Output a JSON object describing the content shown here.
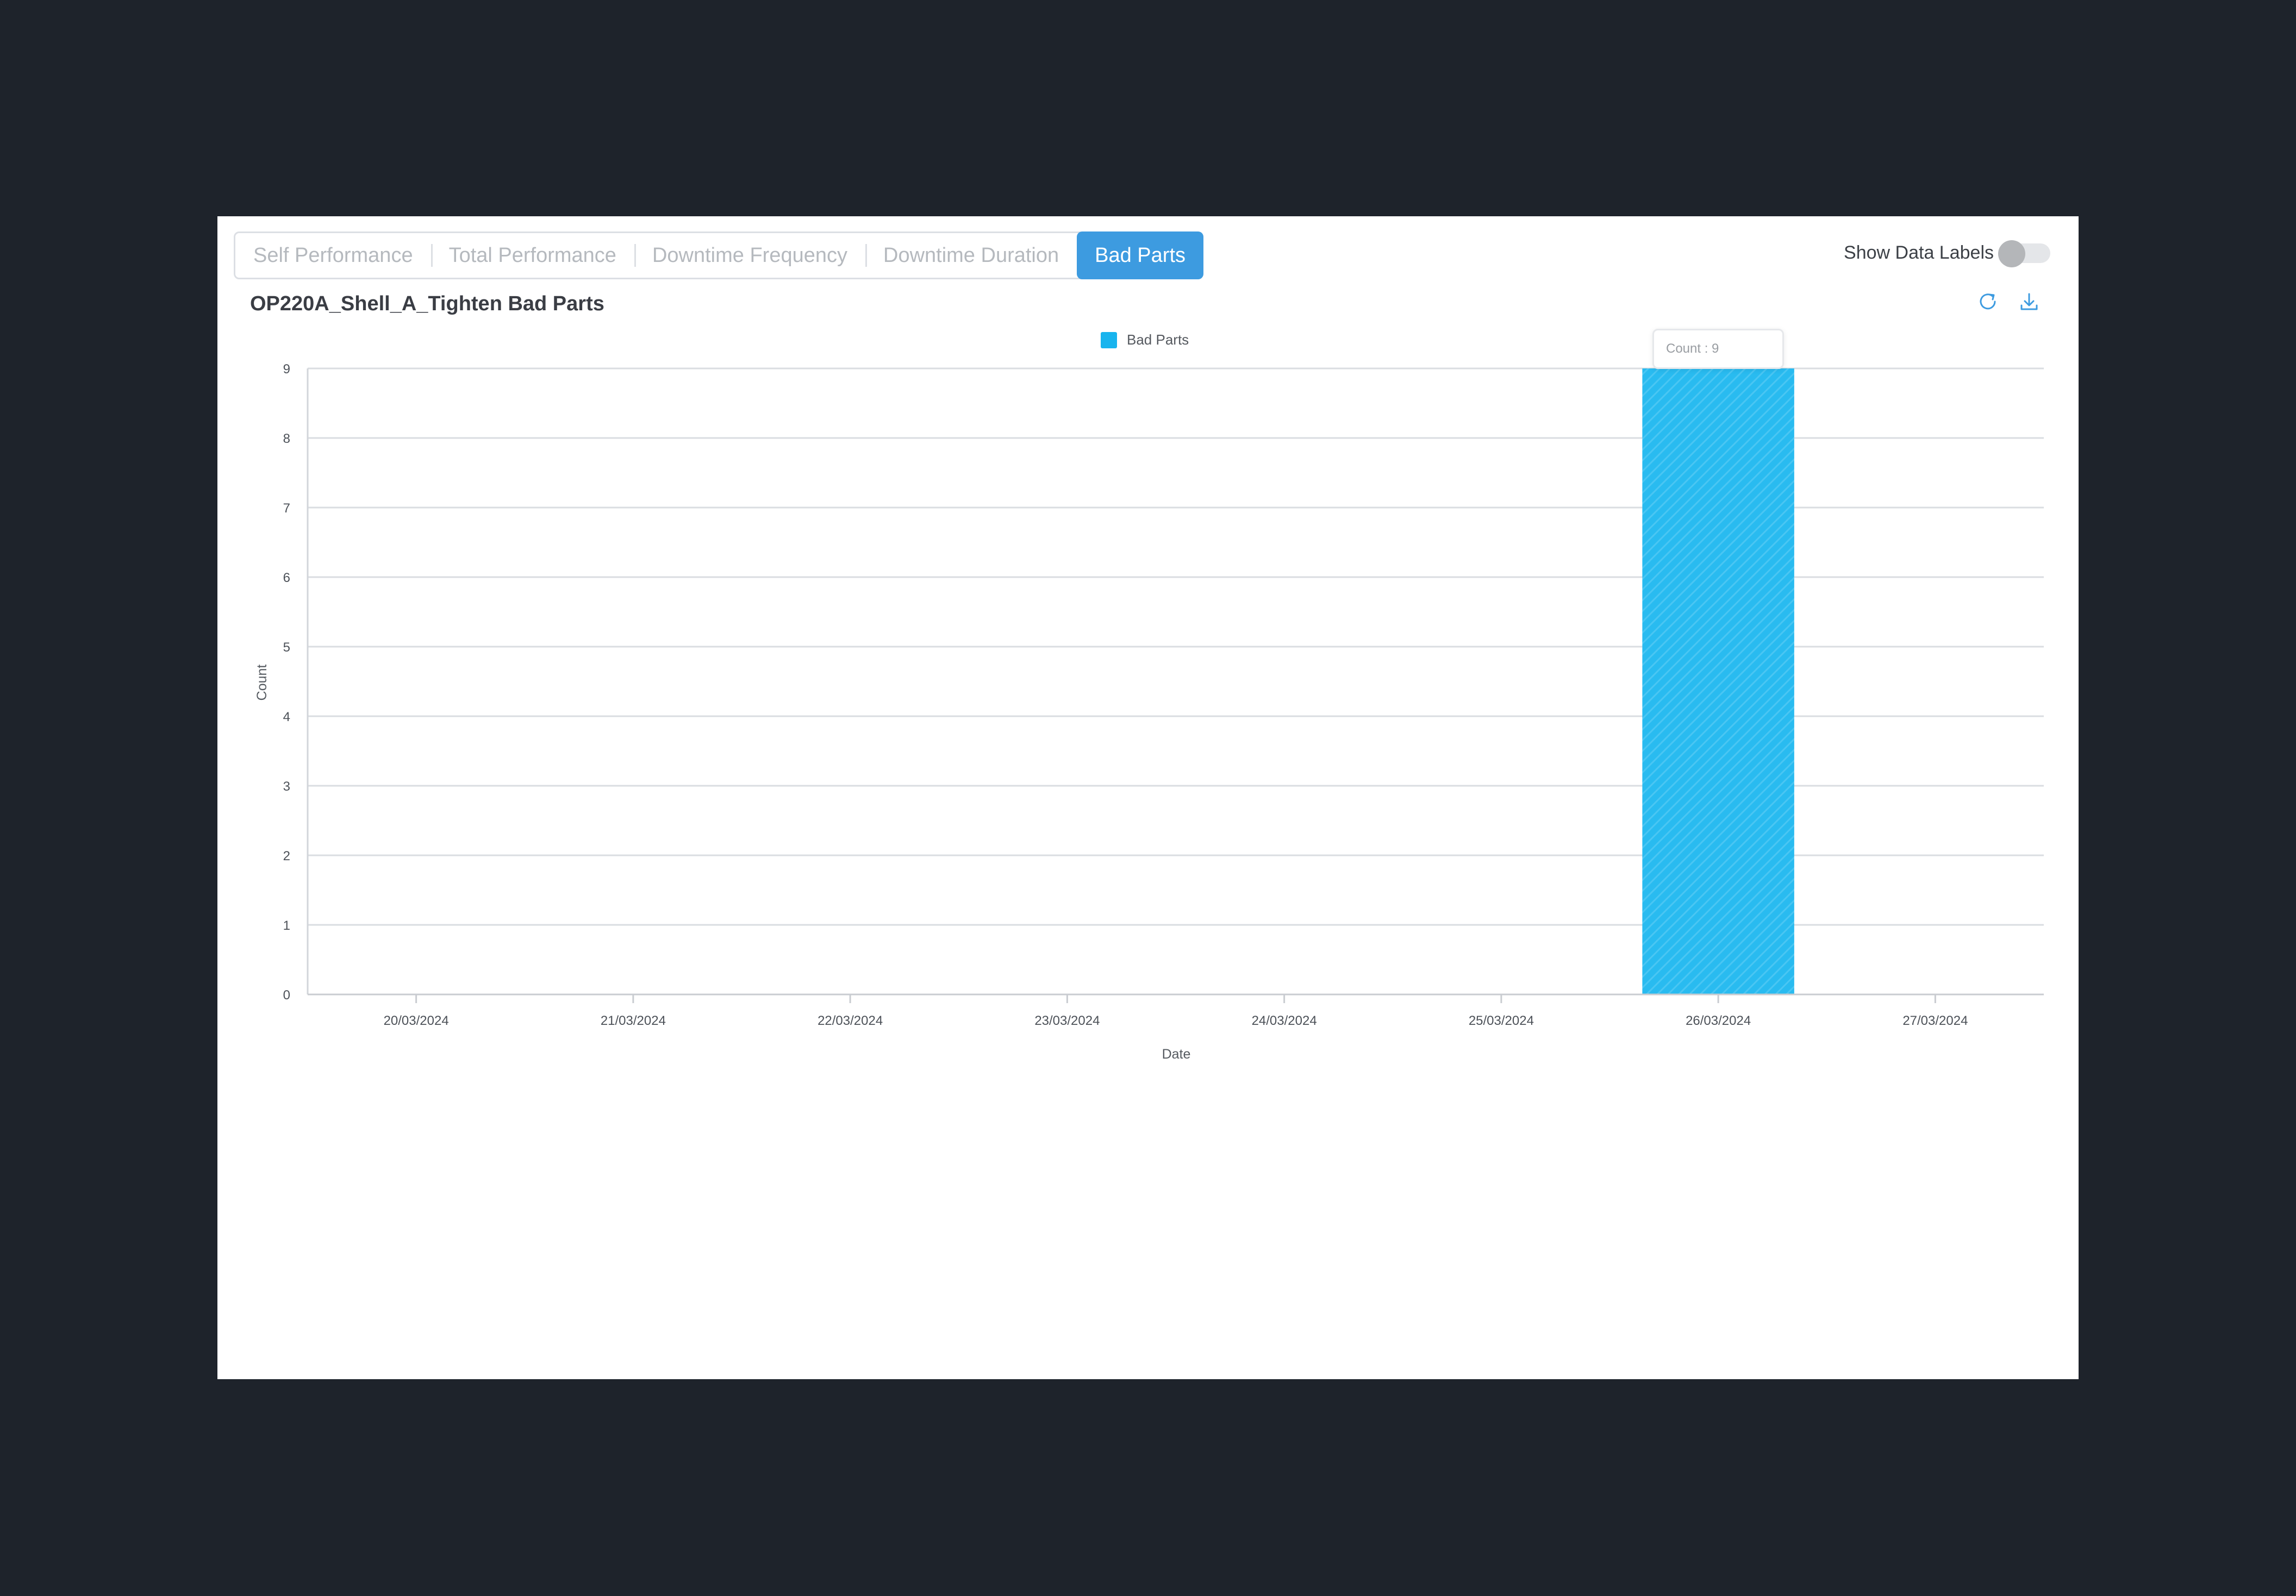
{
  "tabs": [
    {
      "label": "Self Performance",
      "active": false
    },
    {
      "label": "Total Performance",
      "active": false
    },
    {
      "label": "Downtime Frequency",
      "active": false
    },
    {
      "label": "Downtime Duration",
      "active": false
    },
    {
      "label": "Bad Parts",
      "active": true
    }
  ],
  "toggle": {
    "label": "Show Data Labels",
    "on": false
  },
  "toolbar": {
    "refresh_icon": "refresh-icon",
    "download_icon": "download-icon"
  },
  "tooltip": {
    "text": "Count : 9"
  },
  "colors": {
    "accent": "#3d9be0",
    "bar": "#18b4ee"
  },
  "chart_data": {
    "type": "bar",
    "title": "OP220A_Shell_A_Tighten Bad Parts",
    "xlabel": "Date",
    "ylabel": "Count",
    "categories": [
      "20/03/2024",
      "21/03/2024",
      "22/03/2024",
      "23/03/2024",
      "24/03/2024",
      "25/03/2024",
      "26/03/2024",
      "27/03/2024"
    ],
    "series": [
      {
        "name": "Bad Parts",
        "values": [
          0,
          0,
          0,
          0,
          0,
          0,
          9,
          0
        ]
      }
    ],
    "ylim": [
      0,
      9
    ],
    "yticks": [
      0,
      1,
      2,
      3,
      4,
      5,
      6,
      7,
      8,
      9
    ],
    "grid": true,
    "legend_position": "top"
  }
}
